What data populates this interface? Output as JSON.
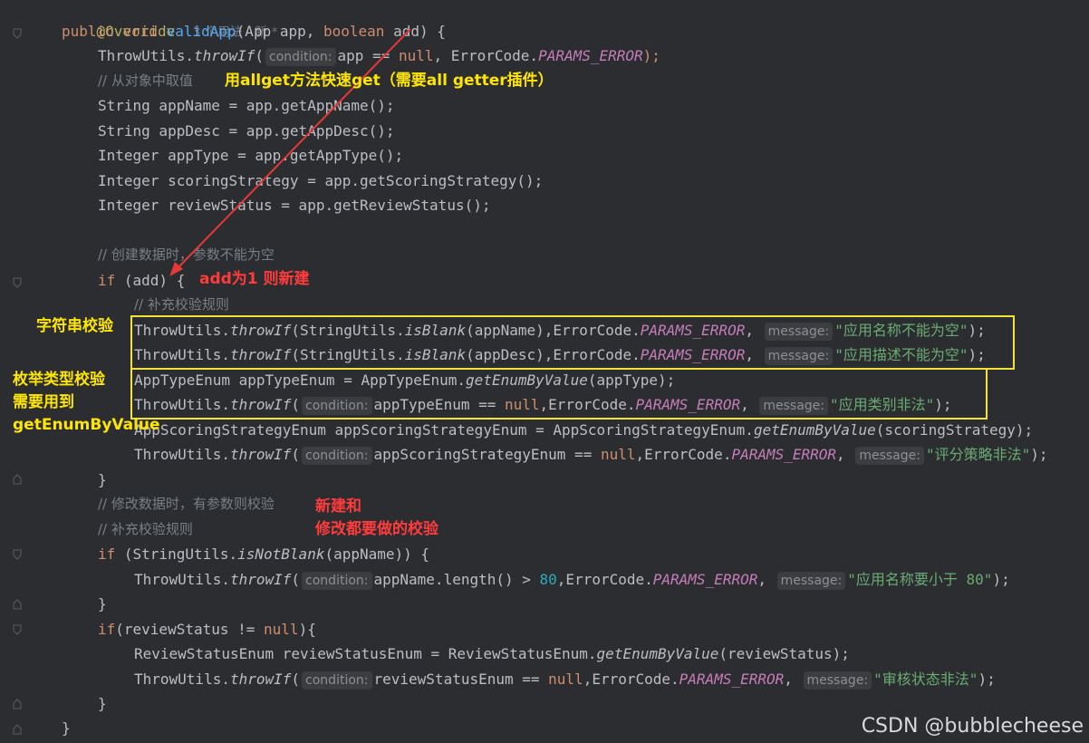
{
  "code": {
    "l1_annotation": "@Override",
    "l1_meta": "3 个用法   新 *",
    "l2": {
      "public": "public",
      "void": "void",
      "name": "validApp",
      "params_open": "(App app, ",
      "boolean": "boolean",
      "params_close": " add) {"
    },
    "l3": {
      "cls": "ThrowUtils.",
      "fn": "throwIf",
      "open": "(",
      "hint": "condition:",
      "expr": "app == ",
      "null": "null",
      "rest": ", ErrorCode.",
      "const": "PARAMS_ERROR",
      "end": ");"
    },
    "l4_comment": "// 从对象中取值",
    "l5": "String appName = app.getAppName();",
    "l6": "String appDesc = app.getAppDesc();",
    "l7": "Integer appType = app.getAppType();",
    "l8": "Integer scoringStrategy = app.getScoringStrategy();",
    "l9": "Integer reviewStatus = app.getReviewStatus();",
    "l11_comment": "// 创建数据时，参数不能为空",
    "l12": {
      "if": "if",
      "rest": " (add) {"
    },
    "l13_comment": "// 补充校验规则",
    "l14": {
      "cls": "ThrowUtils.",
      "fn": "throwIf",
      "a": "(StringUtils.",
      "blank": "isBlank",
      "b": "(appName),ErrorCode.",
      "const": "PARAMS_ERROR",
      "c": ", ",
      "hint": "message:",
      "str": "\"应用名称不能为空\"",
      "end": ");"
    },
    "l15": {
      "cls": "ThrowUtils.",
      "fn": "throwIf",
      "a": "(StringUtils.",
      "blank": "isBlank",
      "b": "(appDesc),ErrorCode.",
      "const": "PARAMS_ERROR",
      "c": ", ",
      "hint": "message:",
      "str": "\"应用描述不能为空\"",
      "end": ");"
    },
    "l16": {
      "a": "AppTypeEnum appTypeEnum = AppTypeEnum.",
      "fn": "getEnumByValue",
      "b": "(appType);"
    },
    "l17": {
      "cls": "ThrowUtils.",
      "fn": "throwIf",
      "open": "(",
      "hint": "condition:",
      "expr": "appTypeEnum == ",
      "null": "null",
      "b": ",ErrorCode.",
      "const": "PARAMS_ERROR",
      "c": ", ",
      "hint2": "message:",
      "str": "\"应用类别非法\"",
      "end": ");"
    },
    "l18": {
      "a": "AppScoringStrategyEnum appScoringStrategyEnum = AppScoringStrategyEnum.",
      "fn": "getEnumByValue",
      "b": "(scoringStrategy);"
    },
    "l19": {
      "cls": "ThrowUtils.",
      "fn": "throwIf",
      "open": "(",
      "hint": "condition:",
      "expr": "appScoringStrategyEnum == ",
      "null": "null",
      "b": ",ErrorCode.",
      "const": "PARAMS_ERROR",
      "c": ", ",
      "hint2": "message:",
      "str": "\"评分策略非法\"",
      "end": ");"
    },
    "l20": "}",
    "l21_comment": "// 修改数据时，有参数则校验",
    "l22_comment": "// 补充校验规则",
    "l23": {
      "if": "if",
      "a": " (StringUtils.",
      "fn": "isNotBlank",
      "b": "(appName)) {"
    },
    "l24": {
      "cls": "ThrowUtils.",
      "fn": "throwIf",
      "open": "(",
      "hint": "condition:",
      "expr": "appName.length() > ",
      "num": "80",
      "b": ",ErrorCode.",
      "const": "PARAMS_ERROR",
      "c": ", ",
      "hint2": "message:",
      "str": "\"应用名称要小于 80\"",
      "end": ");"
    },
    "l25": "}",
    "l26": {
      "if": "if",
      "a": "(reviewStatus != ",
      "null": "null",
      "b": "){"
    },
    "l27": {
      "a": "ReviewStatusEnum reviewStatusEnum = ReviewStatusEnum.",
      "fn": "getEnumByValue",
      "b": "(reviewStatus);"
    },
    "l28": {
      "cls": "ThrowUtils.",
      "fn": "throwIf",
      "open": "(",
      "hint": "condition:",
      "expr": "reviewStatusEnum == ",
      "null": "null",
      "b": ",ErrorCode.",
      "const": "PARAMS_ERROR",
      "c": ", ",
      "hint2": "message:",
      "str": "\"审核状态非法\"",
      "end": ");"
    },
    "l29": "}",
    "l30": "}"
  },
  "annotations": {
    "allget": "用allget方法快速get（需要all getter插件）",
    "add_new": "add为1 则新建",
    "string_check": "字符串校验",
    "enum_check_1": "枚举类型校验",
    "enum_check_2": "需要用到",
    "enum_check_3": "getEnumByValue",
    "both_1": "新建和",
    "both_2": "修改都要做的校验"
  },
  "watermark": "CSDN @bubblecheese",
  "colors": {
    "background": "#2b2d30",
    "keyword": "#cf8e6d",
    "function": "#56a8f5",
    "string": "#6aab73",
    "constant": "#c77dbb",
    "comment": "#7a7e85",
    "box": "#f2e23a",
    "arrow": "#e53935",
    "note_yellow": "#ffe600",
    "note_red": "#ff3b3b"
  }
}
